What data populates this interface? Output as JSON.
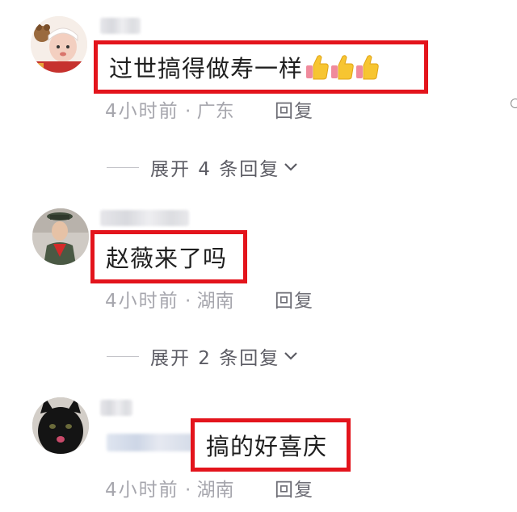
{
  "comments": [
    {
      "text": "过世搞得做寿一样",
      "emoji": "thumbs-up-icon",
      "emoji_count": 3,
      "time": "4小时前",
      "location": "广东",
      "reply_label": "回复",
      "expand_label": "展开 4 条回复"
    },
    {
      "text": "赵薇来了吗",
      "time": "4小时前",
      "location": "湖南",
      "reply_label": "回复",
      "expand_label": "展开 2 条回复"
    },
    {
      "text": "搞的好喜庆",
      "time": "4小时前",
      "location": "湖南",
      "reply_label": "回复"
    }
  ],
  "meta_separator": "·",
  "colors": {
    "highlight_border": "#e3141c",
    "meta_text": "#a6a6ad",
    "reply_text": "#6c6c74"
  }
}
